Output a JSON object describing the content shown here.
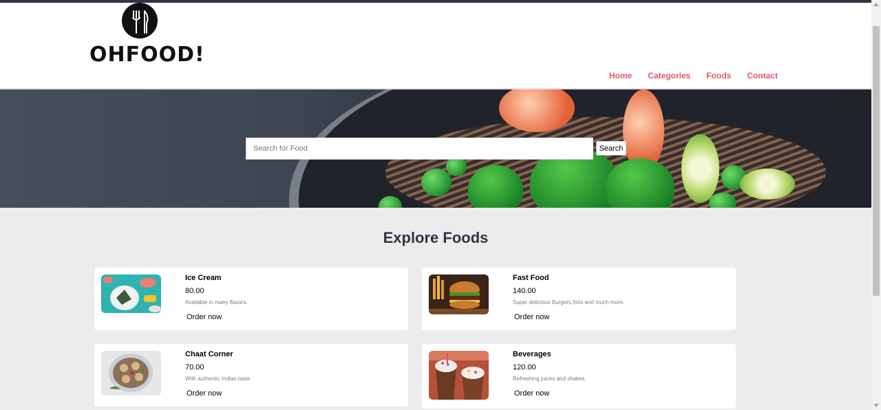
{
  "brand": {
    "logo_icon": "fork-knife-icon",
    "name": "OHFOOD!"
  },
  "nav": [
    {
      "label": "Home"
    },
    {
      "label": "Categories"
    },
    {
      "label": "Foods"
    },
    {
      "label": "Contact"
    }
  ],
  "search": {
    "placeholder": "Search for Food",
    "button_label": "Search"
  },
  "section_title": "Explore Foods",
  "foods": [
    {
      "title": "Ice Cream",
      "price": "80.00",
      "description": "Available in many flavors.",
      "action": "Order now"
    },
    {
      "title": "Fast Food",
      "price": "140.00",
      "description": "Super delicious Burgers,fries and much more.",
      "action": "Order now"
    },
    {
      "title": "Chaat Corner",
      "price": "70.00",
      "description": "With authentic Indian taste.",
      "action": "Order now"
    },
    {
      "title": "Beverages",
      "price": "120.00",
      "description": "Refreshing juices and shakes.",
      "action": "Order now"
    }
  ],
  "colors": {
    "accent": "#e8536b",
    "heading": "#2f3542",
    "muted": "#747d8c",
    "page_bg": "#ececec"
  }
}
